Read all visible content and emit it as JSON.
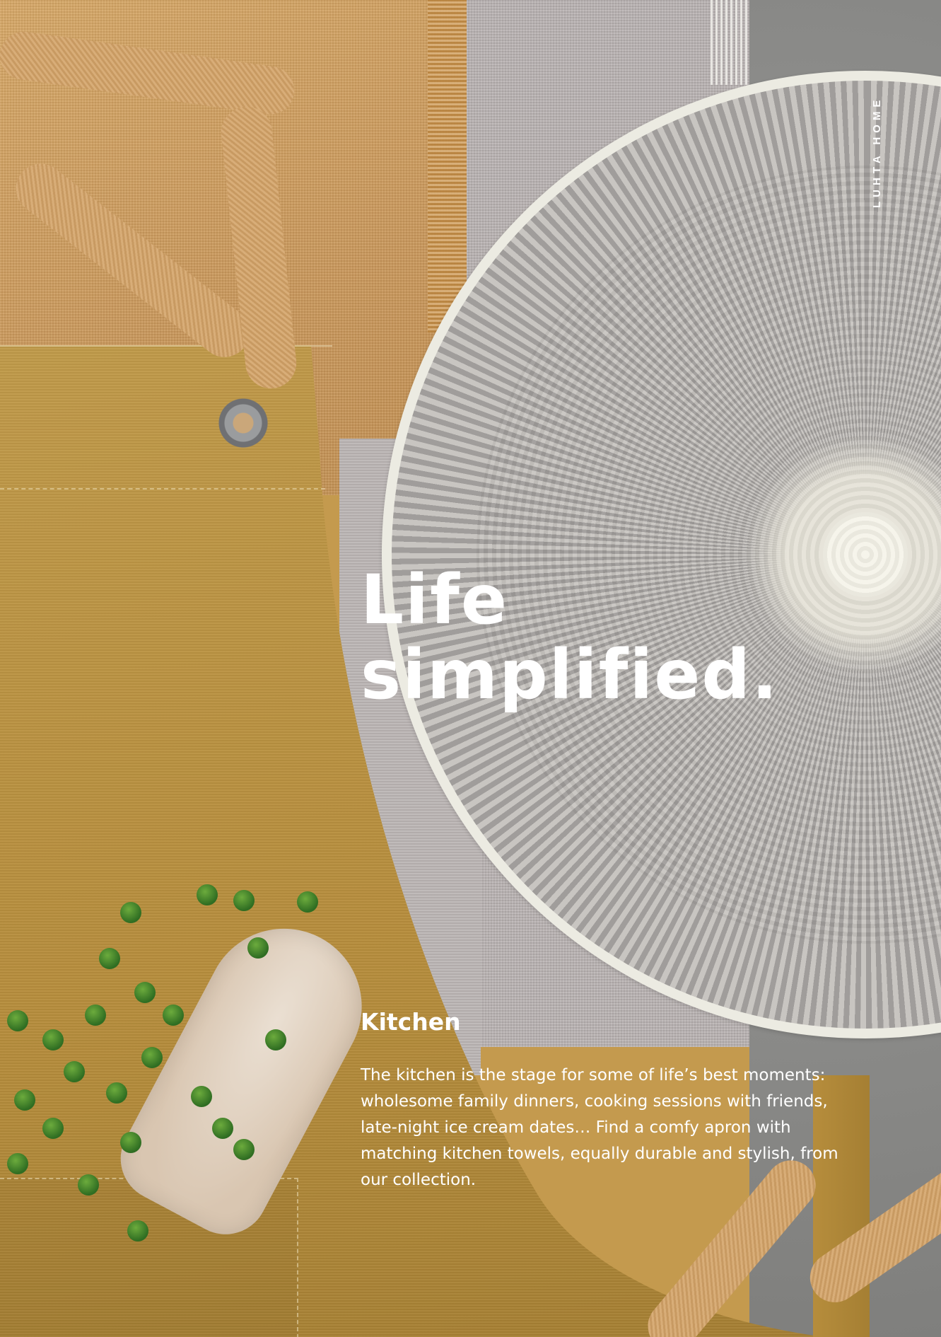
{
  "brand": "LUHTA HOME",
  "headline": {
    "line1": "Life",
    "line2": "simplified."
  },
  "section": {
    "heading": "Kitchen",
    "body": "The kitchen is the stage for some of life’s best moments: wholesome family dinners, cooking sessions with friends, late-night ice cream dates… Find a comfy apron with matching kitchen towels, equally durable and stylish, from our collection."
  },
  "colors": {
    "text": "#ffffff",
    "apron": "#b68d3c",
    "placemat": "#b0adaa"
  }
}
